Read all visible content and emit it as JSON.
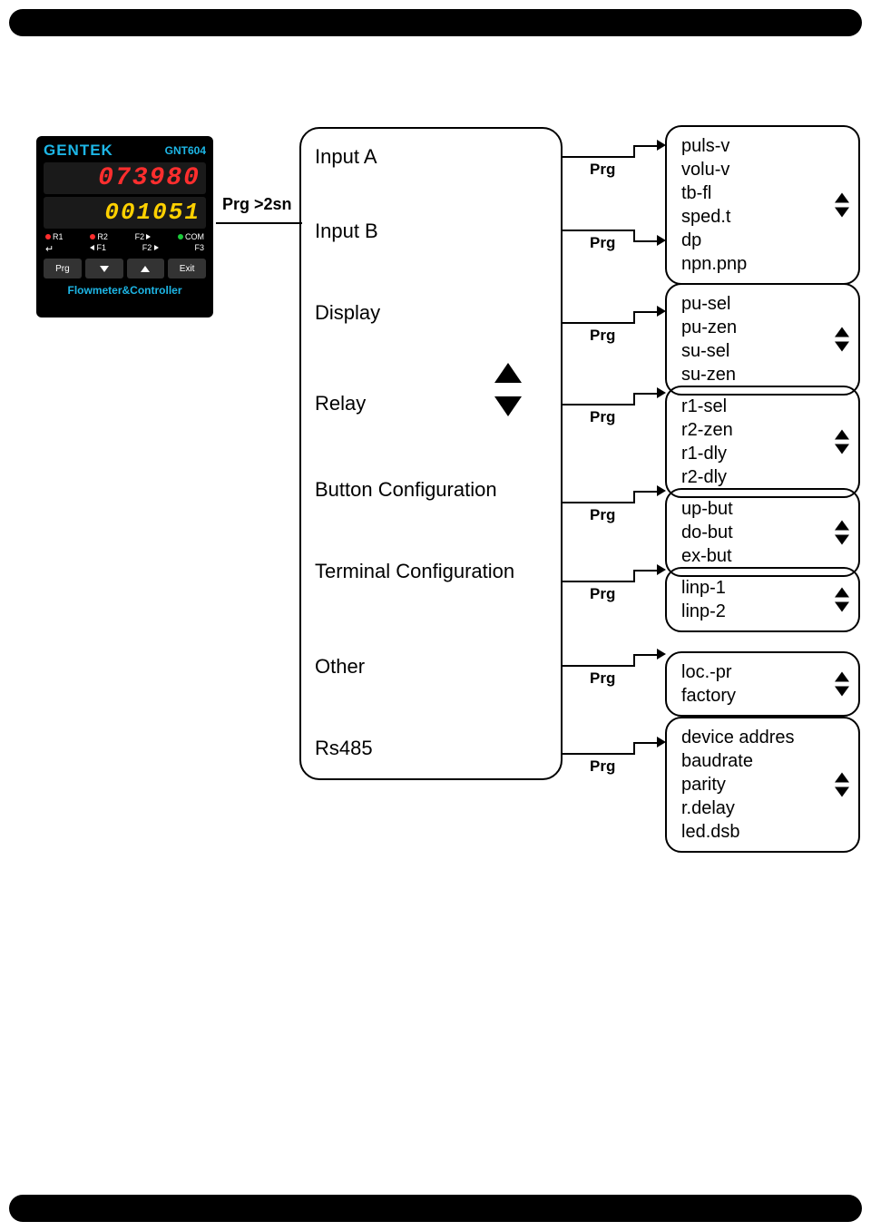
{
  "device": {
    "brand": "GENTEK",
    "model": "GNT604",
    "display1": "073980",
    "display2": "001051",
    "led_row": {
      "r1": "R1",
      "r2": "R2",
      "f2a": "F2",
      "com": "COM"
    },
    "arrow_row": {
      "f1": "F1",
      "f2": "F2",
      "f3": "F3"
    },
    "buttons": {
      "prg": "Prg",
      "exit": "Exit"
    },
    "footer": "Flowmeter&Controller"
  },
  "entry_label": "Prg >2sn",
  "prg_label": "Prg",
  "menu": {
    "input_a": "Input A",
    "input_b": "Input B",
    "display": "Display",
    "relay": "Relay",
    "button_config": "Button Configuration",
    "terminal_config": "Terminal Configuration",
    "other": "Other",
    "rs485": "Rs485"
  },
  "sub": {
    "inputa": [
      "puls-v",
      "volu-v",
      "tb-fl",
      "sped.t",
      "dp",
      "npn.pnp"
    ],
    "display": [
      "pu-sel",
      "pu-zen",
      "su-sel",
      "su-zen"
    ],
    "relay": [
      "r1-sel",
      "r2-zen",
      "r1-dly",
      "r2-dly"
    ],
    "button": [
      "up-but",
      "do-but",
      "ex-but"
    ],
    "terminal": [
      "linp-1",
      "linp-2"
    ],
    "other": [
      "loc.-pr",
      "factory"
    ],
    "rs485": [
      "device addres",
      "baudrate",
      "parity",
      "r.delay",
      "led.dsb"
    ]
  }
}
